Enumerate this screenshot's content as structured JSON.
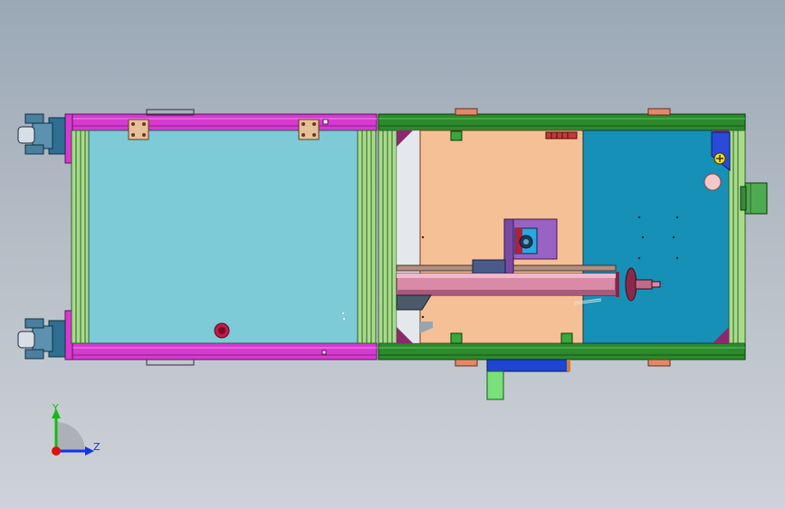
{
  "triad": {
    "y_label": "Y",
    "z_label": "Z",
    "y_color": "#11bb11",
    "z_color": "#1133ee",
    "x_color": "#dd1111"
  },
  "colors": {
    "frame_magenta": "#d63ad0",
    "frame_green": "#2c8a2c",
    "extrusion_light_green": "#a8dc8a",
    "left_panel_cyan": "#7ccbd6",
    "mid_panel_peach": "#f6c096",
    "right_panel_teal": "#1690b6",
    "cylinder_pink": "#d88aa6",
    "cylinder_dark": "#7a2a4a",
    "bracket_purple": "#9a62c2",
    "motor_green": "#4eaa4e",
    "blue_plate": "#1e46d2",
    "caster_blue": "#2e6f93"
  }
}
